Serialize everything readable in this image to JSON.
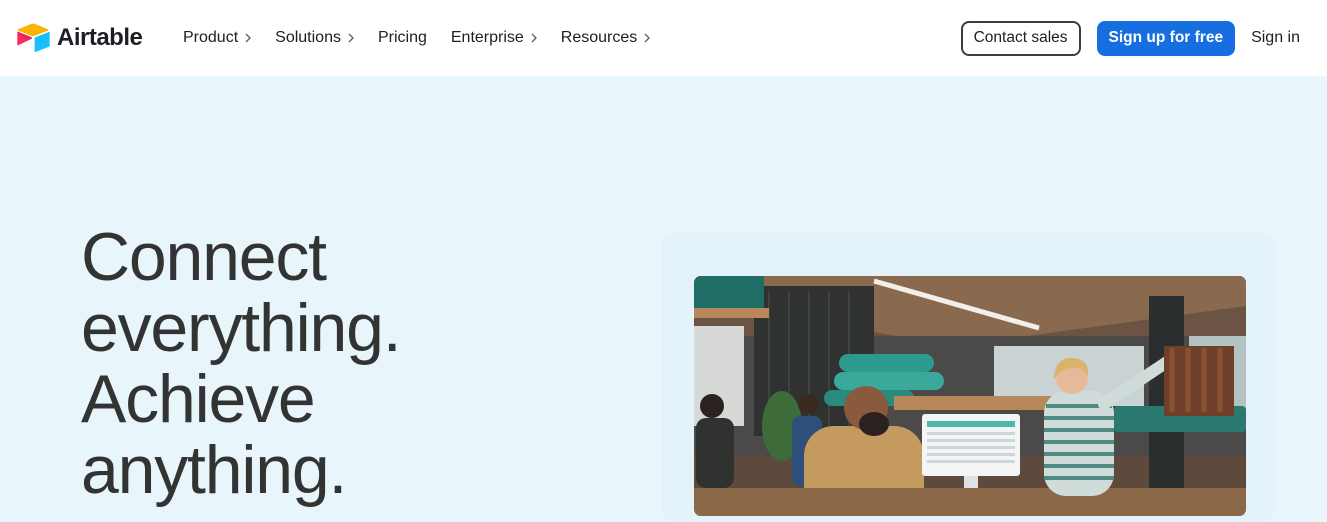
{
  "brand": {
    "name": "Airtable",
    "logo_icon": "airtable-logo-icon",
    "colors": {
      "yellow": "#FCB400",
      "red": "#F82B60",
      "blue": "#18BFFF",
      "dark_blue": "#2D7FF9"
    }
  },
  "nav": {
    "items": [
      {
        "label": "Product",
        "has_chevron": true
      },
      {
        "label": "Solutions",
        "has_chevron": true
      },
      {
        "label": "Pricing",
        "has_chevron": false
      },
      {
        "label": "Enterprise",
        "has_chevron": true
      },
      {
        "label": "Resources",
        "has_chevron": true
      }
    ],
    "contact_sales": "Contact sales",
    "sign_up": "Sign up for free",
    "sign_in": "Sign in"
  },
  "hero": {
    "headline_lines": [
      "Connect",
      "everything.",
      "Achieve",
      "anything."
    ],
    "image_icon": "office-team-photo"
  },
  "colors": {
    "background": "#e8f6fb",
    "primary_button": "#166ee1",
    "text": "#333333"
  }
}
